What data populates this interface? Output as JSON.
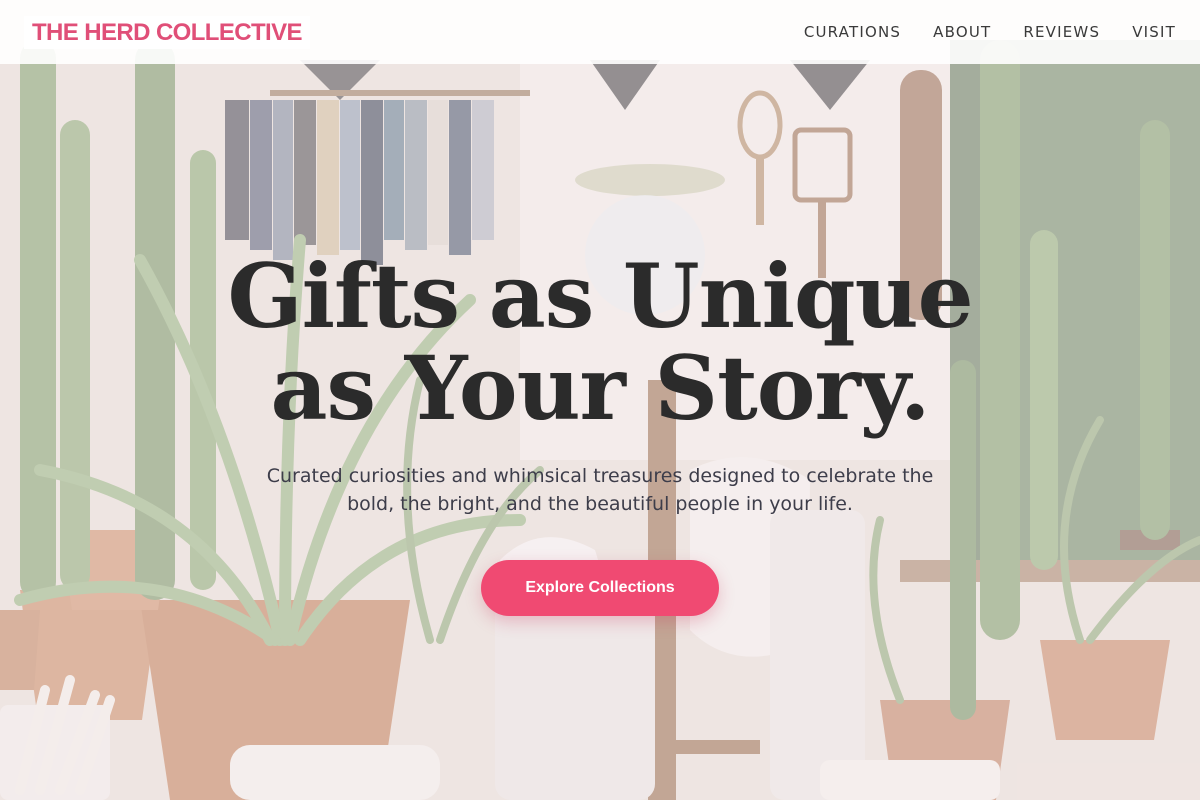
{
  "brand": {
    "name": "THE HERD COLLECTIVE",
    "color": "#e04f78"
  },
  "nav": {
    "items": [
      {
        "label": "CURATIONS"
      },
      {
        "label": "ABOUT"
      },
      {
        "label": "REVIEWS"
      },
      {
        "label": "VISIT"
      }
    ]
  },
  "hero": {
    "title_line1": "Gifts as Unique",
    "title_line2": "as Your Story.",
    "subtitle": "Curated curiosities and whimsical treasures designed to celebrate the bold, the bright, and the beautiful people in your life.",
    "cta_label": "Explore Collections",
    "cta_color": "#f04a72"
  }
}
